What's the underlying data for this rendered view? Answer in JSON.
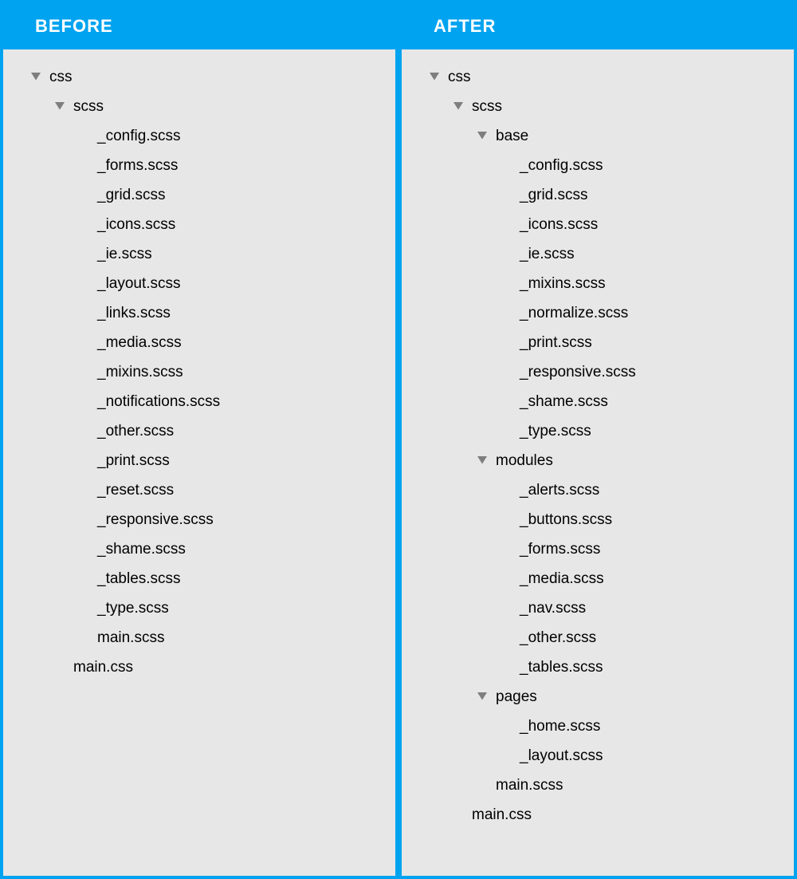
{
  "panels": {
    "before": {
      "title": "BEFORE",
      "tree": [
        {
          "label": "css",
          "depth": 0,
          "isFolder": true,
          "expanded": true
        },
        {
          "label": "scss",
          "depth": 1,
          "isFolder": true,
          "expanded": true
        },
        {
          "label": "_config.scss",
          "depth": 2,
          "isFolder": false
        },
        {
          "label": "_forms.scss",
          "depth": 2,
          "isFolder": false
        },
        {
          "label": "_grid.scss",
          "depth": 2,
          "isFolder": false
        },
        {
          "label": "_icons.scss",
          "depth": 2,
          "isFolder": false
        },
        {
          "label": "_ie.scss",
          "depth": 2,
          "isFolder": false
        },
        {
          "label": "_layout.scss",
          "depth": 2,
          "isFolder": false
        },
        {
          "label": "_links.scss",
          "depth": 2,
          "isFolder": false
        },
        {
          "label": "_media.scss",
          "depth": 2,
          "isFolder": false
        },
        {
          "label": "_mixins.scss",
          "depth": 2,
          "isFolder": false
        },
        {
          "label": "_notifications.scss",
          "depth": 2,
          "isFolder": false
        },
        {
          "label": "_other.scss",
          "depth": 2,
          "isFolder": false
        },
        {
          "label": "_print.scss",
          "depth": 2,
          "isFolder": false
        },
        {
          "label": "_reset.scss",
          "depth": 2,
          "isFolder": false
        },
        {
          "label": "_responsive.scss",
          "depth": 2,
          "isFolder": false
        },
        {
          "label": "_shame.scss",
          "depth": 2,
          "isFolder": false
        },
        {
          "label": "_tables.scss",
          "depth": 2,
          "isFolder": false
        },
        {
          "label": "_type.scss",
          "depth": 2,
          "isFolder": false
        },
        {
          "label": "main.scss",
          "depth": 2,
          "isFolder": false
        },
        {
          "label": "main.css",
          "depth": 1,
          "isFolder": false
        }
      ]
    },
    "after": {
      "title": "AFTER",
      "tree": [
        {
          "label": "css",
          "depth": 0,
          "isFolder": true,
          "expanded": true
        },
        {
          "label": "scss",
          "depth": 1,
          "isFolder": true,
          "expanded": true
        },
        {
          "label": "base",
          "depth": 2,
          "isFolder": true,
          "expanded": true
        },
        {
          "label": "_config.scss",
          "depth": 3,
          "isFolder": false
        },
        {
          "label": "_grid.scss",
          "depth": 3,
          "isFolder": false
        },
        {
          "label": "_icons.scss",
          "depth": 3,
          "isFolder": false
        },
        {
          "label": "_ie.scss",
          "depth": 3,
          "isFolder": false
        },
        {
          "label": "_mixins.scss",
          "depth": 3,
          "isFolder": false
        },
        {
          "label": "_normalize.scss",
          "depth": 3,
          "isFolder": false
        },
        {
          "label": "_print.scss",
          "depth": 3,
          "isFolder": false
        },
        {
          "label": "_responsive.scss",
          "depth": 3,
          "isFolder": false
        },
        {
          "label": "_shame.scss",
          "depth": 3,
          "isFolder": false
        },
        {
          "label": "_type.scss",
          "depth": 3,
          "isFolder": false
        },
        {
          "label": "modules",
          "depth": 2,
          "isFolder": true,
          "expanded": true
        },
        {
          "label": "_alerts.scss",
          "depth": 3,
          "isFolder": false
        },
        {
          "label": "_buttons.scss",
          "depth": 3,
          "isFolder": false
        },
        {
          "label": "_forms.scss",
          "depth": 3,
          "isFolder": false
        },
        {
          "label": "_media.scss",
          "depth": 3,
          "isFolder": false
        },
        {
          "label": "_nav.scss",
          "depth": 3,
          "isFolder": false
        },
        {
          "label": "_other.scss",
          "depth": 3,
          "isFolder": false
        },
        {
          "label": "_tables.scss",
          "depth": 3,
          "isFolder": false
        },
        {
          "label": "pages",
          "depth": 2,
          "isFolder": true,
          "expanded": true
        },
        {
          "label": "_home.scss",
          "depth": 3,
          "isFolder": false
        },
        {
          "label": "_layout.scss",
          "depth": 3,
          "isFolder": false
        },
        {
          "label": "main.scss",
          "depth": 2,
          "isFolder": false
        },
        {
          "label": "main.css",
          "depth": 1,
          "isFolder": false
        }
      ]
    }
  }
}
